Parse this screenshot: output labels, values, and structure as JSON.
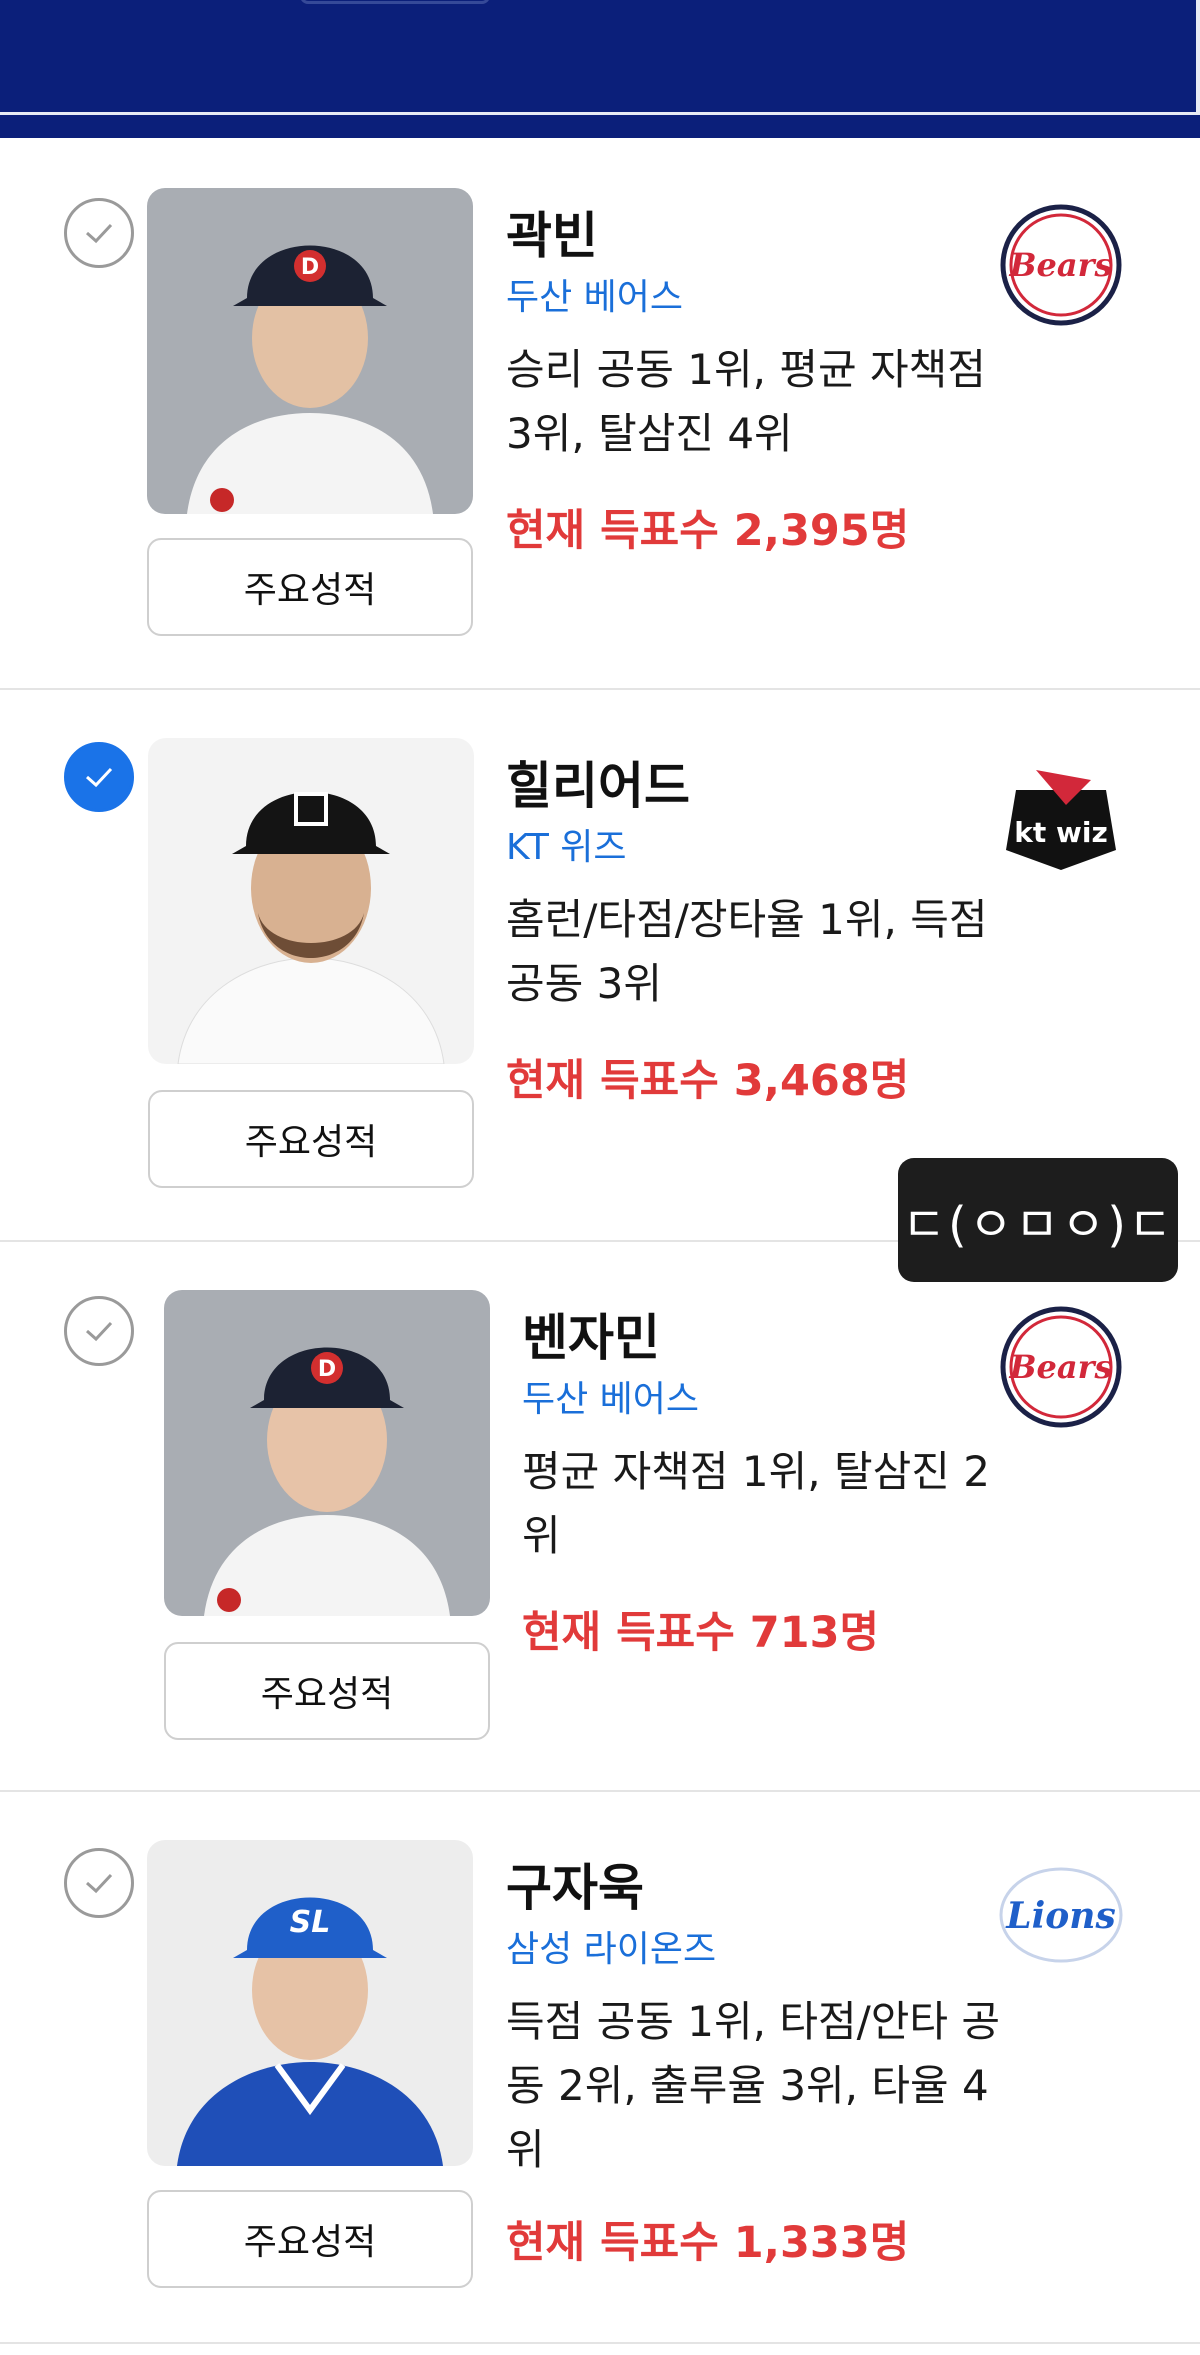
{
  "button_label": "주요성적",
  "colors": {
    "banner": "#0b1f7a",
    "team_text": "#1a6fd9",
    "votes_text": "#e13a3a",
    "check_on": "#1a73e8"
  },
  "players": [
    {
      "name": "곽빈",
      "team": "두산 베어스",
      "description": "승리 공동 1위, 평균 자책점 3위, 탈삼진 4위",
      "votes": "현재 득표수 2,395명",
      "selected": false,
      "logo_icon": "doosan-bears-logo-icon"
    },
    {
      "name": "힐리어드",
      "team": "KT 위즈",
      "description": "홈런/타점/장타율 1위, 득점 공동 3위",
      "votes": "현재 득표수 3,468명",
      "selected": true,
      "logo_icon": "kt-wiz-logo-icon"
    },
    {
      "name": "벤자민",
      "team": "두산 베어스",
      "description": "평균 자책점 1위, 탈삼진 2위",
      "votes": "현재 득표수 713명",
      "selected": false,
      "logo_icon": "doosan-bears-logo-icon"
    },
    {
      "name": "구자욱",
      "team": "삼성 라이온즈",
      "description": "득점 공동 1위, 타점/안타 공동 2위, 출루율 3위, 타율 4위",
      "votes": "현재 득표수 1,333명",
      "selected": false,
      "logo_icon": "samsung-lions-logo-icon"
    }
  ],
  "emoticon": "ㄷ(ㅇㅁㅇ)ㄷ"
}
